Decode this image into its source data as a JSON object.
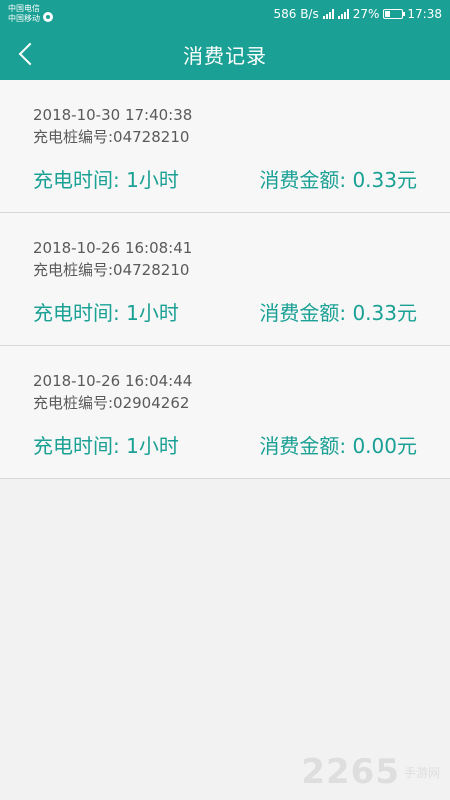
{
  "status_bar": {
    "carrier_1": "中国电信",
    "carrier_2": "中国移动",
    "network_speed": "586 B/s",
    "battery": "27%",
    "time": "17:38"
  },
  "header": {
    "title": "消费记录"
  },
  "records": [
    {
      "datetime": "2018-10-30 17:40:38",
      "pile": "充电桩编号:04728210",
      "duration": "充电时间: 1小时",
      "amount": "消费金额: 0.33元"
    },
    {
      "datetime": "2018-10-26 16:08:41",
      "pile": "充电桩编号:04728210",
      "duration": "充电时间: 1小时",
      "amount": "消费金额: 0.33元"
    },
    {
      "datetime": "2018-10-26 16:04:44",
      "pile": "充电桩编号:02904262",
      "duration": "充电时间: 1小时",
      "amount": "消费金额: 0.00元"
    }
  ],
  "watermark": {
    "number": "2265",
    "text": "手游网"
  },
  "colors": {
    "accent": "#1aa094",
    "background": "#f2f2f2"
  }
}
